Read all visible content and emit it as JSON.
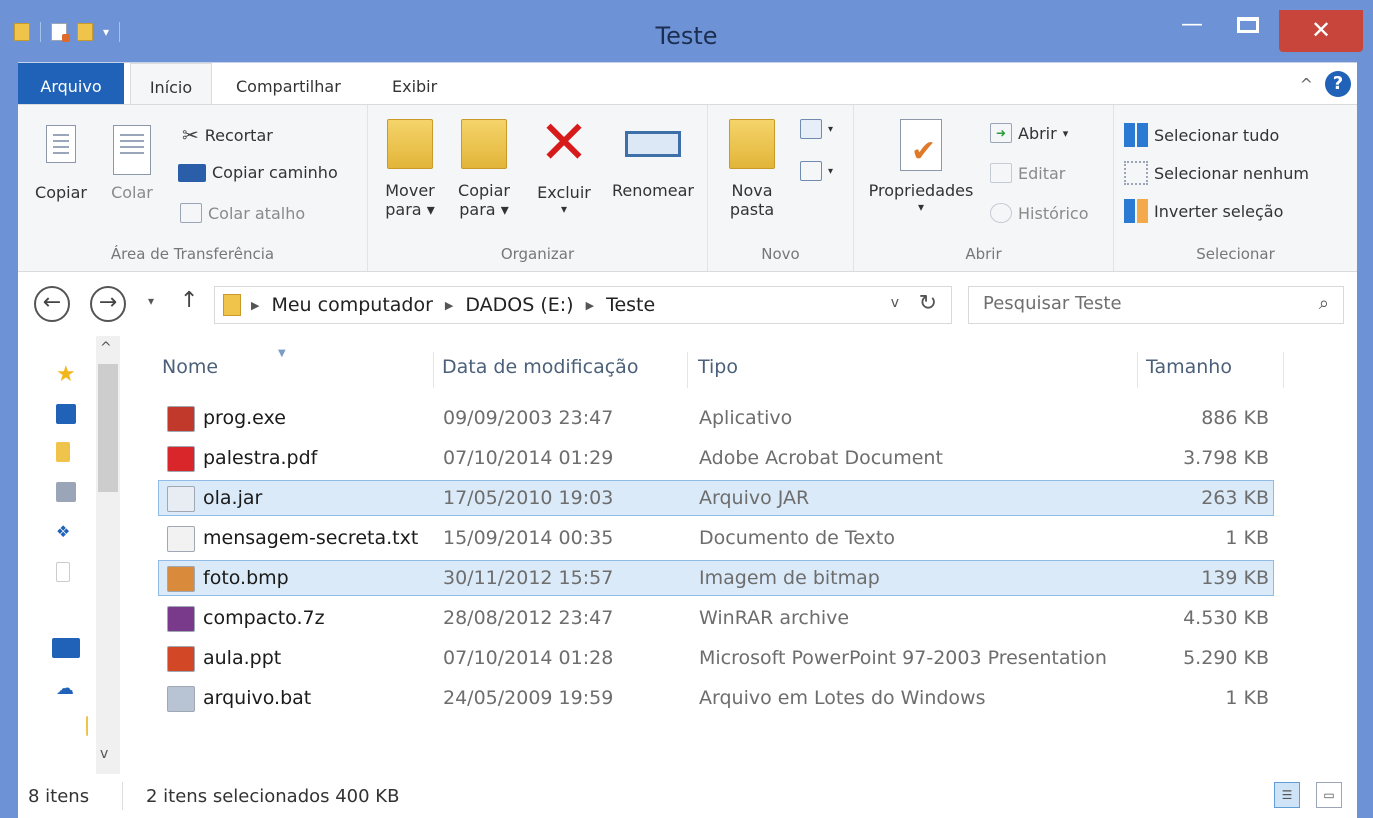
{
  "window": {
    "title": "Teste",
    "minimize": "—",
    "close": "✕"
  },
  "ribbon": {
    "tabs": {
      "file": "Arquivo",
      "home": "Início",
      "share": "Compartilhar",
      "view": "Exibir"
    },
    "help": "?",
    "clipboard": {
      "copy": "Copiar",
      "paste": "Colar",
      "cut": "Recortar",
      "copy_path": "Copiar caminho",
      "paste_shortcut": "Colar atalho",
      "label": "Área de Transferência"
    },
    "organize": {
      "move_to": "Mover",
      "copy_to": "Copiar",
      "to": "para",
      "delete": "Excluir",
      "rename": "Renomear",
      "label": "Organizar"
    },
    "new": {
      "new_folder_1": "Nova",
      "new_folder_2": "pasta",
      "label": "Novo"
    },
    "open": {
      "properties": "Propriedades",
      "open": "Abrir",
      "edit": "Editar",
      "history": "Histórico",
      "label": "Abrir"
    },
    "select": {
      "select_all": "Selecionar tudo",
      "select_none": "Selecionar nenhum",
      "invert": "Inverter seleção",
      "label": "Selecionar"
    }
  },
  "address": {
    "crumbs": [
      "Meu computador",
      "DADOS (E:)",
      "Teste"
    ],
    "search_placeholder": "Pesquisar Teste"
  },
  "columns": {
    "name": "Nome",
    "date": "Data de modificação",
    "type": "Tipo",
    "size": "Tamanho"
  },
  "files": [
    {
      "name": "prog.exe",
      "date": "09/09/2003 23:47",
      "type": "Aplicativo",
      "size": "886 KB",
      "icon": "exe-icon",
      "color": "#c0392b"
    },
    {
      "name": "palestra.pdf",
      "date": "07/10/2014 01:29",
      "type": "Adobe Acrobat Document",
      "size": "3.798 KB",
      "icon": "pdf-icon",
      "color": "#d9262b"
    },
    {
      "name": "ola.jar",
      "date": "17/05/2010 19:03",
      "type": "Arquivo JAR",
      "size": "263 KB",
      "icon": "jar-icon",
      "color": "#e8edf3"
    },
    {
      "name": "mensagem-secreta.txt",
      "date": "15/09/2014 00:35",
      "type": "Documento de Texto",
      "size": "1 KB",
      "icon": "txt-icon",
      "color": "#f2f2f2"
    },
    {
      "name": "foto.bmp",
      "date": "30/11/2012 15:57",
      "type": "Imagem de bitmap",
      "size": "139 KB",
      "icon": "bmp-icon",
      "color": "#d98a3a"
    },
    {
      "name": "compacto.7z",
      "date": "28/08/2012 23:47",
      "type": "WinRAR archive",
      "size": "4.530 KB",
      "icon": "archive-icon",
      "color": "#7a3a8c"
    },
    {
      "name": "aula.ppt",
      "date": "07/10/2014 01:28",
      "type": "Microsoft PowerPoint 97-2003 Presentation",
      "size": "5.290 KB",
      "icon": "ppt-icon",
      "color": "#d24726"
    },
    {
      "name": "arquivo.bat",
      "date": "24/05/2009 19:59",
      "type": "Arquivo em Lotes do Windows",
      "size": "1 KB",
      "icon": "bat-icon",
      "color": "#b8c4d4"
    }
  ],
  "selected_rows": [
    2,
    4
  ],
  "status": {
    "count": "8 itens",
    "selection": "2 itens selecionados  400 KB"
  },
  "colors": {
    "titlebar": "#6d93d6",
    "file_tab": "#1f62b8",
    "close_button": "#c7453b",
    "selection": "#dbeaf8"
  }
}
